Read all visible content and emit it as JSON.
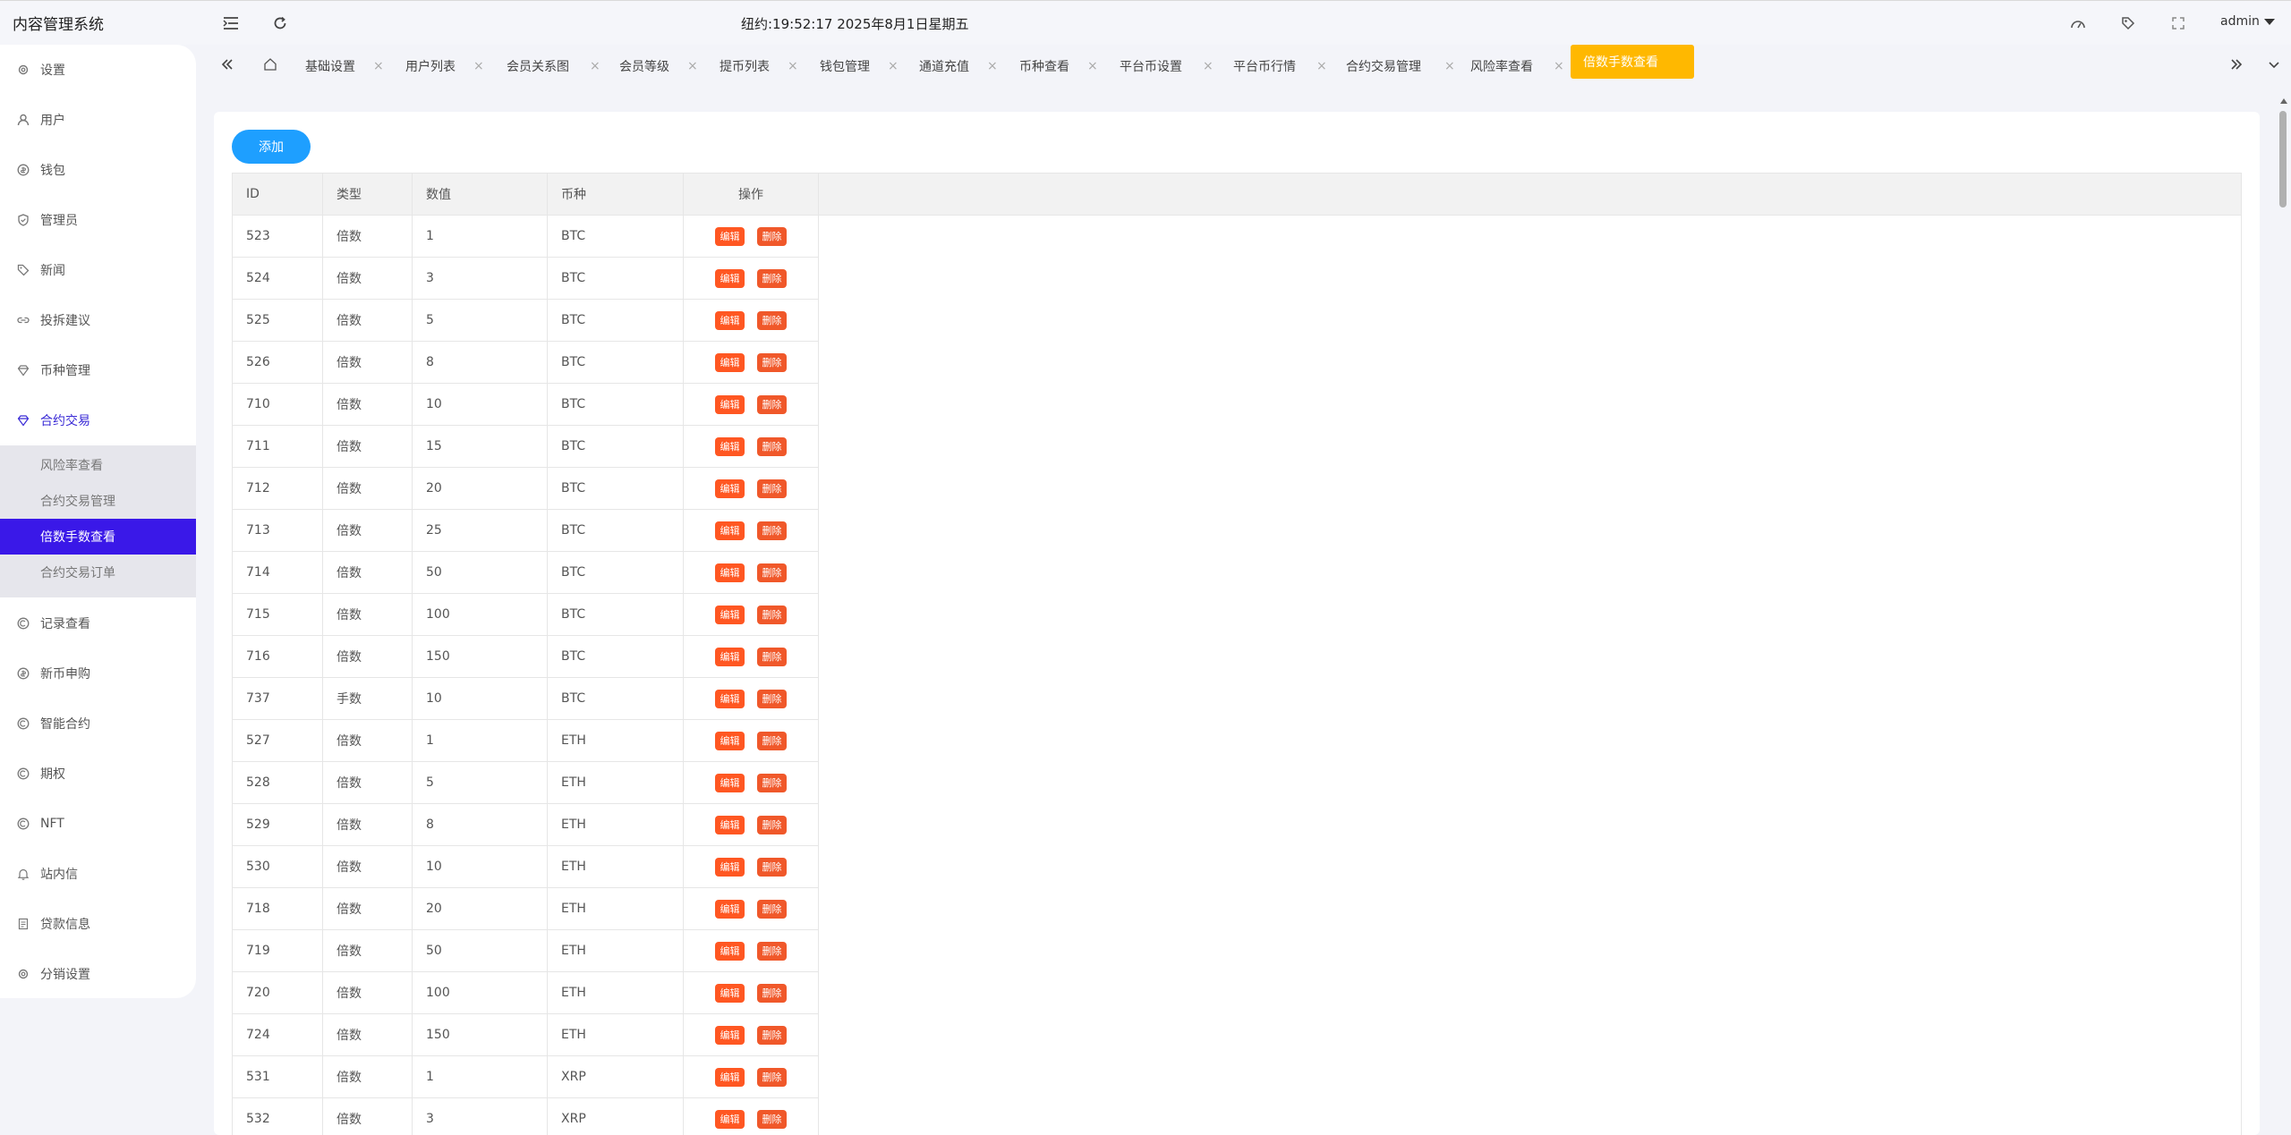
{
  "app": {
    "title": "内容管理系统",
    "clock": "纽约:19:52:17 2025年8月1日星期五",
    "user": "admin"
  },
  "header_icons": [
    "menu-fold-icon",
    "refresh-icon",
    "theme-icon",
    "tag-icon",
    "fullscreen-icon"
  ],
  "sidebar": {
    "items": [
      {
        "label": "设置",
        "icon": "gear-icon"
      },
      {
        "label": "用户",
        "icon": "user-icon"
      },
      {
        "label": "钱包",
        "icon": "coin-icon"
      },
      {
        "label": "管理员",
        "icon": "shield-icon"
      },
      {
        "label": "新闻",
        "icon": "tag-icon"
      },
      {
        "label": "投拆建议",
        "icon": "link-icon"
      },
      {
        "label": "币种管理",
        "icon": "diamond-icon"
      },
      {
        "label": "合约交易",
        "icon": "diamond-icon"
      },
      {
        "label": "记录查看",
        "icon": "record-icon"
      },
      {
        "label": "新币申购",
        "icon": "coin-icon"
      },
      {
        "label": "智能合约",
        "icon": "record-icon"
      },
      {
        "label": "期权",
        "icon": "record-icon"
      },
      {
        "label": "NFT",
        "icon": "record-icon"
      },
      {
        "label": "站内信",
        "icon": "bell-icon"
      },
      {
        "label": "贷款信息",
        "icon": "doc-icon"
      },
      {
        "label": "分销设置",
        "icon": "gear-icon"
      }
    ],
    "submenu": [
      {
        "label": "风险率查看"
      },
      {
        "label": "合约交易管理"
      },
      {
        "label": "倍数手数查看"
      },
      {
        "label": "合约交易订单"
      }
    ]
  },
  "tabs": [
    {
      "label": "基础设置"
    },
    {
      "label": "用户列表"
    },
    {
      "label": "会员关系图"
    },
    {
      "label": "会员等级"
    },
    {
      "label": "提币列表"
    },
    {
      "label": "钱包管理"
    },
    {
      "label": "通道充值"
    },
    {
      "label": "币种查看"
    },
    {
      "label": "平台币设置"
    },
    {
      "label": "平台币行情"
    },
    {
      "label": "合约交易管理"
    },
    {
      "label": "风险率查看"
    },
    {
      "label": "倍数手数查看"
    }
  ],
  "toolbar": {
    "add_label": "添加"
  },
  "table": {
    "headers": [
      "ID",
      "类型",
      "数值",
      "币种",
      "操作"
    ],
    "edit_label": "编辑",
    "delete_label": "删除",
    "rows": [
      [
        "523",
        "倍数",
        "1",
        "BTC"
      ],
      [
        "524",
        "倍数",
        "3",
        "BTC"
      ],
      [
        "525",
        "倍数",
        "5",
        "BTC"
      ],
      [
        "526",
        "倍数",
        "8",
        "BTC"
      ],
      [
        "710",
        "倍数",
        "10",
        "BTC"
      ],
      [
        "711",
        "倍数",
        "15",
        "BTC"
      ],
      [
        "712",
        "倍数",
        "20",
        "BTC"
      ],
      [
        "713",
        "倍数",
        "25",
        "BTC"
      ],
      [
        "714",
        "倍数",
        "50",
        "BTC"
      ],
      [
        "715",
        "倍数",
        "100",
        "BTC"
      ],
      [
        "716",
        "倍数",
        "150",
        "BTC"
      ],
      [
        "737",
        "手数",
        "10",
        "BTC"
      ],
      [
        "527",
        "倍数",
        "1",
        "ETH"
      ],
      [
        "528",
        "倍数",
        "5",
        "ETH"
      ],
      [
        "529",
        "倍数",
        "8",
        "ETH"
      ],
      [
        "530",
        "倍数",
        "10",
        "ETH"
      ],
      [
        "718",
        "倍数",
        "20",
        "ETH"
      ],
      [
        "719",
        "倍数",
        "50",
        "ETH"
      ],
      [
        "720",
        "倍数",
        "100",
        "ETH"
      ],
      [
        "724",
        "倍数",
        "150",
        "ETH"
      ],
      [
        "531",
        "倍数",
        "1",
        "XRP"
      ],
      [
        "532",
        "倍数",
        "3",
        "XRP"
      ]
    ]
  },
  "colors": {
    "accent": "#3a18e8",
    "active_tab": "#ffb800",
    "add_button": "#1e9fff",
    "action_button": "#ff5722"
  }
}
